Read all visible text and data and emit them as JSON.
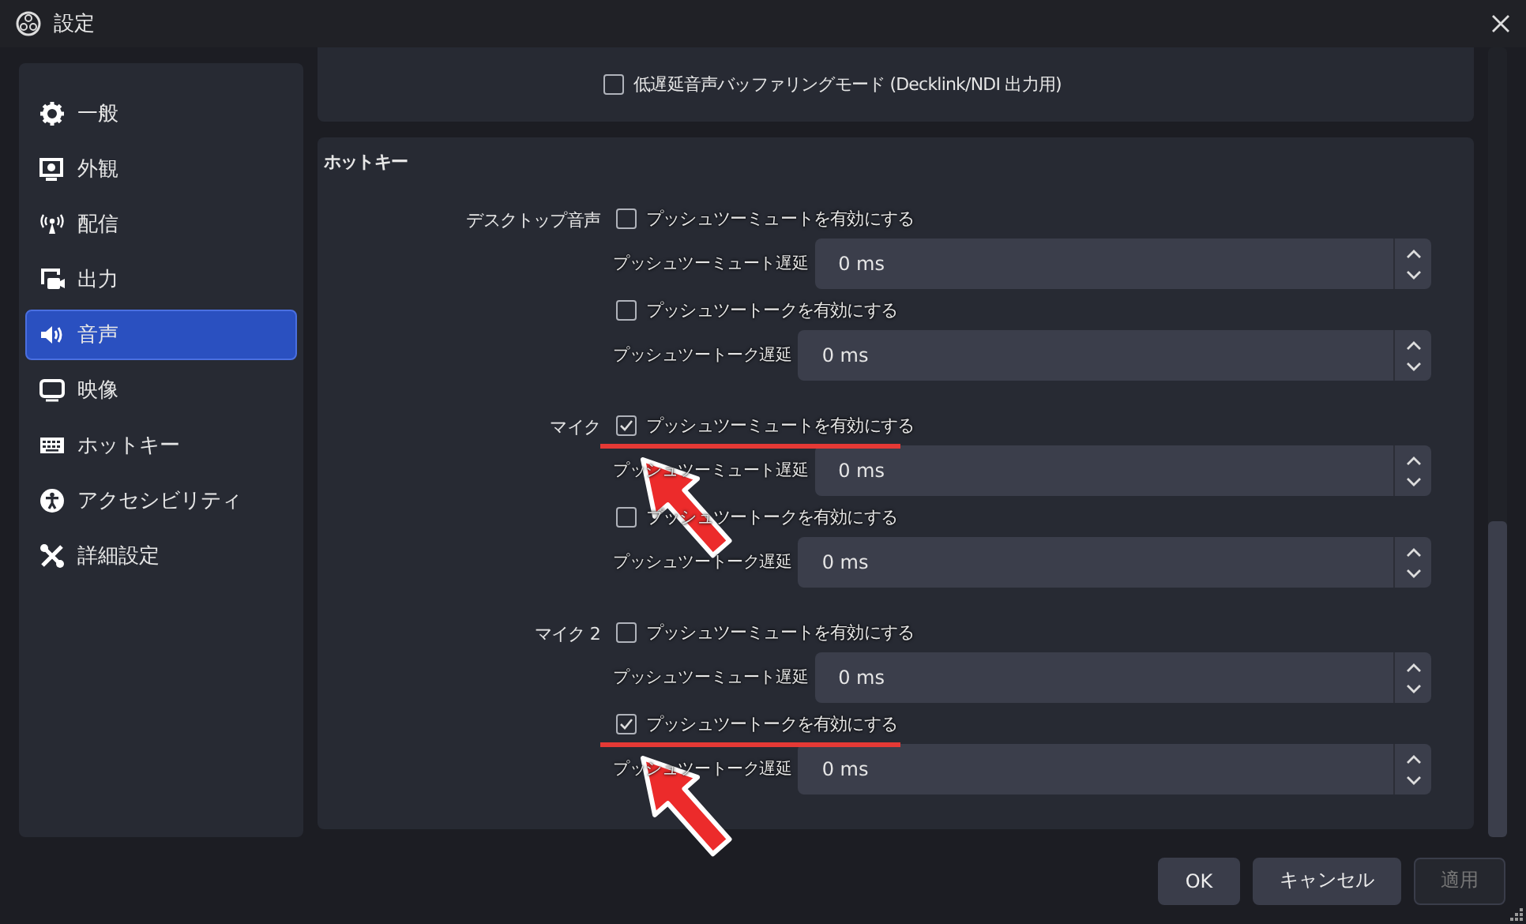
{
  "window": {
    "title": "設定"
  },
  "sidebar": {
    "items": [
      {
        "label": "一般",
        "selected": false
      },
      {
        "label": "外観",
        "selected": false
      },
      {
        "label": "配信",
        "selected": false
      },
      {
        "label": "出力",
        "selected": false
      },
      {
        "label": "音声",
        "selected": true
      },
      {
        "label": "映像",
        "selected": false
      },
      {
        "label": "ホットキー",
        "selected": false
      },
      {
        "label": "アクセシビリティ",
        "selected": false
      },
      {
        "label": "詳細設定",
        "selected": false
      }
    ]
  },
  "advanced_panel": {
    "checkbox": {
      "label": "低遅延音声バッファリングモード (Decklink/NDI 出力用)",
      "checked": false
    }
  },
  "hotkeys": {
    "title": "ホットキー",
    "groups": [
      {
        "label": "デスクトップ音声",
        "rows": [
          {
            "kind": "checkbox",
            "label": "プッシュツーミュートを有効にする",
            "checked": false,
            "annotated": false
          },
          {
            "kind": "delay",
            "label": "プッシュツーミュート遅延",
            "value": "0 ms"
          },
          {
            "kind": "checkbox",
            "label": "プッシュツートークを有効にする",
            "checked": false,
            "annotated": false
          },
          {
            "kind": "delay",
            "label": "プッシュツートーク遅延",
            "value": "0 ms"
          }
        ]
      },
      {
        "label": "マイク",
        "rows": [
          {
            "kind": "checkbox",
            "label": "プッシュツーミュートを有効にする",
            "checked": true,
            "annotated": true
          },
          {
            "kind": "delay",
            "label": "プッシュツーミュート遅延",
            "value": "0 ms"
          },
          {
            "kind": "checkbox",
            "label": "プッシュツートークを有効にする",
            "checked": false,
            "annotated": false
          },
          {
            "kind": "delay",
            "label": "プッシュツートーク遅延",
            "value": "0 ms"
          }
        ]
      },
      {
        "label": "マイク 2",
        "rows": [
          {
            "kind": "checkbox",
            "label": "プッシュツーミュートを有効にする",
            "checked": false,
            "annotated": false
          },
          {
            "kind": "delay",
            "label": "プッシュツーミュート遅延",
            "value": "0 ms"
          },
          {
            "kind": "checkbox",
            "label": "プッシュツートークを有効にする",
            "checked": true,
            "annotated": true
          },
          {
            "kind": "delay",
            "label": "プッシュツートーク遅延",
            "value": "0 ms"
          }
        ]
      }
    ]
  },
  "buttons": [
    {
      "label": "OK",
      "disabled": false
    },
    {
      "label": "キャンセル",
      "disabled": false
    },
    {
      "label": "適用",
      "disabled": true
    }
  ]
}
